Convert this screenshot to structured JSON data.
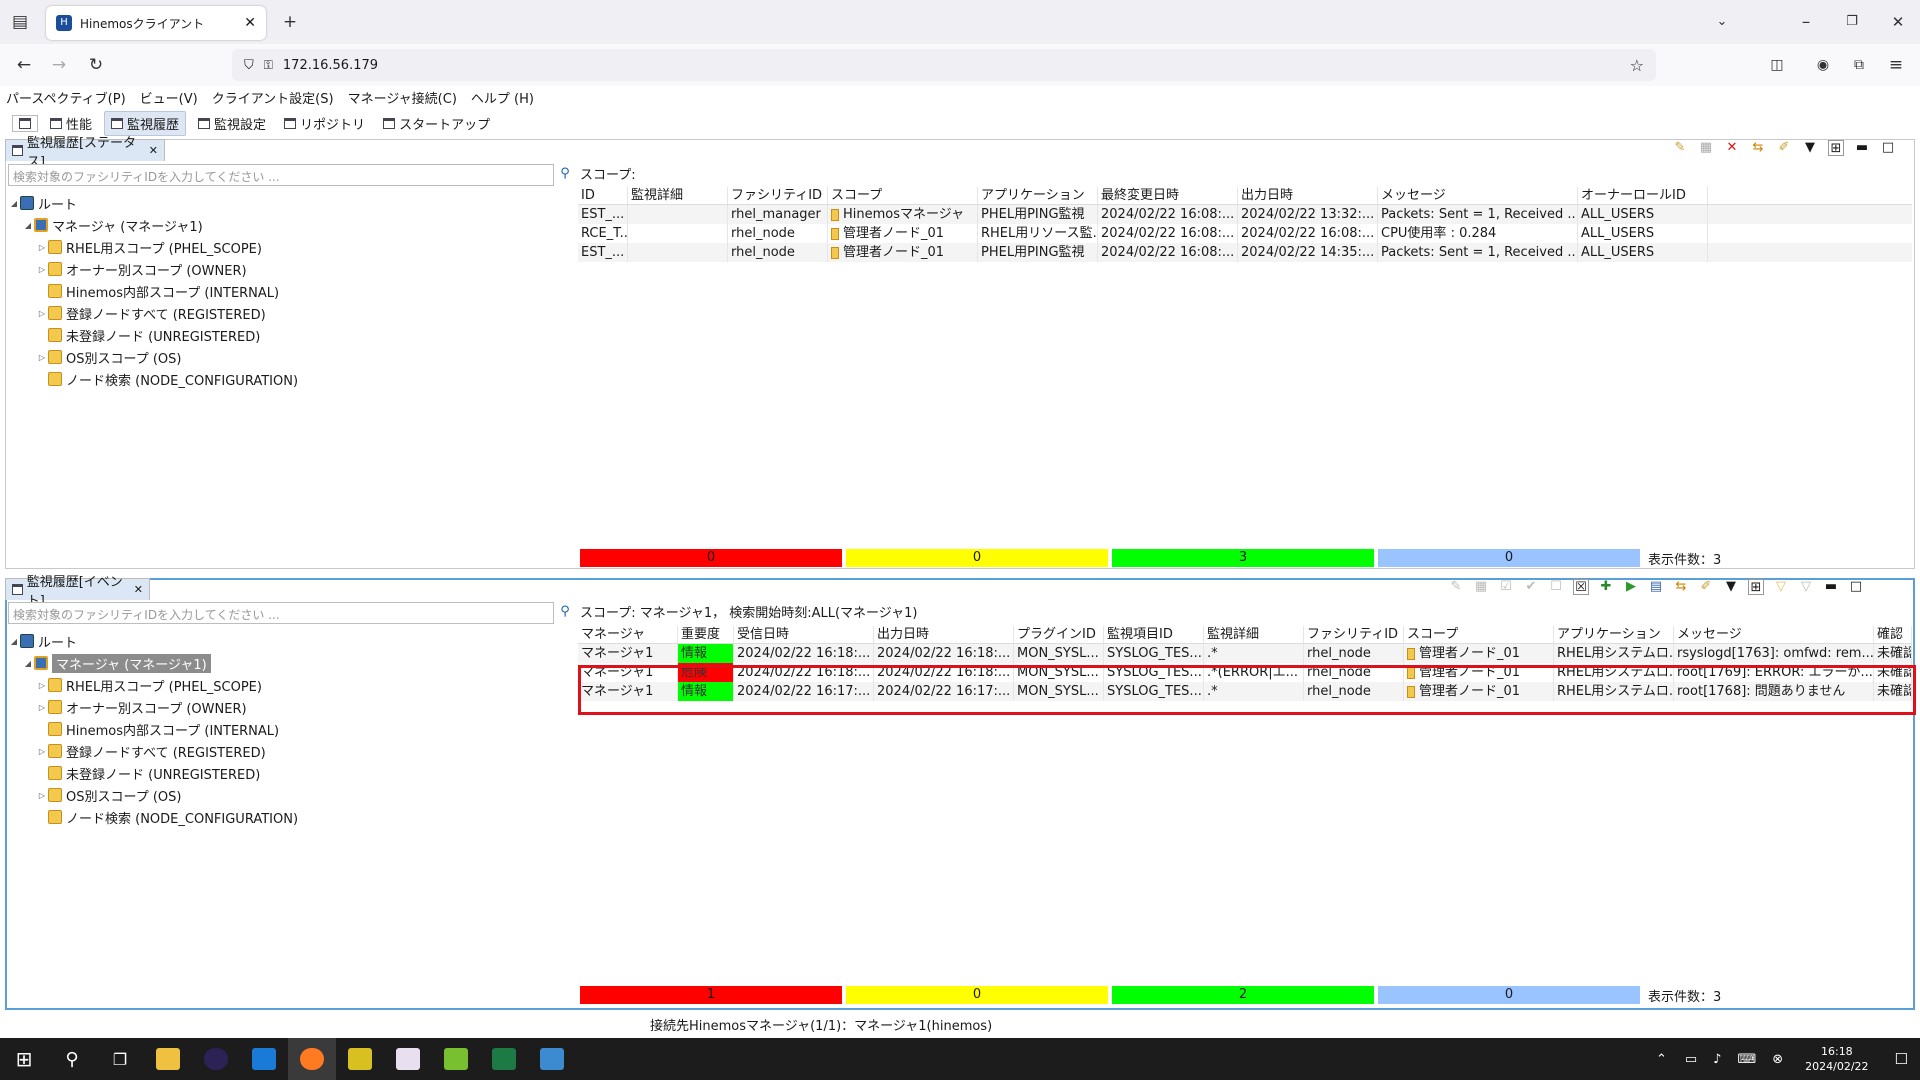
{
  "browser": {
    "tab_title": "Hinemosクライアント",
    "url": "172.16.56.179"
  },
  "menu": [
    "パースペクティブ(P)",
    "ビュー(V)",
    "クライアント設定(S)",
    "マネージャ接続(C)",
    "ヘルプ (H)"
  ],
  "perspectives": [
    {
      "label": "性能",
      "active": false
    },
    {
      "label": "監視履歴",
      "active": true
    },
    {
      "label": "監視設定",
      "active": false
    },
    {
      "label": "リポジトリ",
      "active": false
    },
    {
      "label": "スタートアップ",
      "active": false
    }
  ],
  "status_view": {
    "tab_label": "監視履歴[ステータス]",
    "search_placeholder": "検索対象のファシリティIDを入力してください ...",
    "scope_label": "スコープ:",
    "columns": [
      "ID",
      "監視詳細",
      "ファシリティID",
      "スコープ",
      "アプリケーション",
      "最終変更日時",
      "出力日時",
      "メッセージ",
      "オーナーロールID"
    ],
    "rows": [
      [
        "EST_...",
        "",
        "rhel_manager",
        "Hinemosマネージャ",
        "PHEL用PING監視",
        "2024/02/22 16:08:...",
        "2024/02/22 13:32:...",
        "Packets: Sent = 1, Received ...",
        "ALL_USERS"
      ],
      [
        "RCE_T...",
        "",
        "rhel_node",
        "管理者ノード_01",
        "RHEL用リソース監...",
        "2024/02/22 16:08:...",
        "2024/02/22 16:08:...",
        "CPU使用率 : 0.284",
        "ALL_USERS"
      ],
      [
        "EST_...",
        "",
        "rhel_node",
        "管理者ノード_01",
        "PHEL用PING監視",
        "2024/02/22 16:08:...",
        "2024/02/22 14:35:...",
        "Packets: Sent = 1, Received ...",
        "ALL_USERS"
      ]
    ],
    "counts": [
      "0",
      "0",
      "3",
      "0"
    ],
    "display_count": "表示件数：3"
  },
  "event_view": {
    "tab_label": "監視履歴[イベント]",
    "search_placeholder": "検索対象のファシリティIDを入力してください ...",
    "scope_label": "スコープ: マネージャ1， 検索開始時刻:ALL(マネージャ1)",
    "columns": [
      "マネージャ",
      "重要度",
      "受信日時",
      "出力日時",
      "プラグインID",
      "監視項目ID",
      "監視詳細",
      "ファシリティID",
      "スコープ",
      "アプリケーション",
      "メッセージ",
      "確認"
    ],
    "rows": [
      {
        "cells": [
          "マネージャ1",
          "情報",
          "2024/02/22 16:18:...",
          "2024/02/22 16:18:...",
          "MON_SYSL...",
          "SYSLOG_TES...",
          ".*",
          "rhel_node",
          "管理者ノード_01",
          "RHEL用システムロ...",
          "rsyslogd[1763]: omfwd: rem...",
          "未確認"
        ],
        "sev": "info"
      },
      {
        "cells": [
          "マネージャ1",
          "危険",
          "2024/02/22 16:18:...",
          "2024/02/22 16:18:...",
          "MON_SYSL...",
          "SYSLOG_TES...",
          ".*(ERROR|エ...",
          "rhel_node",
          "管理者ノード_01",
          "RHEL用システムロ...",
          "root[1769]: ERROR: エラーが...",
          "未確認"
        ],
        "sev": "critical"
      },
      {
        "cells": [
          "マネージャ1",
          "情報",
          "2024/02/22 16:17:...",
          "2024/02/22 16:17:...",
          "MON_SYSL...",
          "SYSLOG_TES...",
          ".*",
          "rhel_node",
          "管理者ノード_01",
          "RHEL用システムロ...",
          "root[1768]: 問題ありません",
          "未確認"
        ],
        "sev": "info"
      }
    ],
    "counts": [
      "1",
      "0",
      "2",
      "0"
    ],
    "display_count": "表示件数：3"
  },
  "tree": [
    {
      "label": "ルート",
      "depth": 0,
      "icon": "root-icon",
      "twisty": "open"
    },
    {
      "label": "マネージャ (マネージャ1)",
      "depth": 1,
      "icon": "manager-icon",
      "twisty": "open"
    },
    {
      "label": "RHEL用スコープ (PHEL_SCOPE)",
      "depth": 2,
      "icon": "scope-icon",
      "twisty": "closed"
    },
    {
      "label": "オーナー別スコープ (OWNER)",
      "depth": 2,
      "icon": "scope-icon",
      "twisty": "closed"
    },
    {
      "label": "Hinemos内部スコープ (INTERNAL)",
      "depth": 2,
      "icon": "scope-icon",
      "twisty": ""
    },
    {
      "label": "登録ノードすべて (REGISTERED)",
      "depth": 2,
      "icon": "scope-icon",
      "twisty": "closed"
    },
    {
      "label": "未登録ノード (UNREGISTERED)",
      "depth": 2,
      "icon": "scope-icon",
      "twisty": ""
    },
    {
      "label": "OS別スコープ (OS)",
      "depth": 2,
      "icon": "scope-icon",
      "twisty": "closed"
    },
    {
      "label": "ノード検索 (NODE_CONFIGURATION)",
      "depth": 2,
      "icon": "scope-icon",
      "twisty": ""
    }
  ],
  "statusbar": "接続先Hinemosマネージャ(1/1)：マネージャ1(hinemos)",
  "colors": {
    "critical": "#ff0000",
    "warning": "#ffff00",
    "info": "#00ff00",
    "unknown": "#99c4ff",
    "highlight": "#e0101a"
  },
  "clock": {
    "time": "16:18",
    "date": "2024/02/22"
  }
}
